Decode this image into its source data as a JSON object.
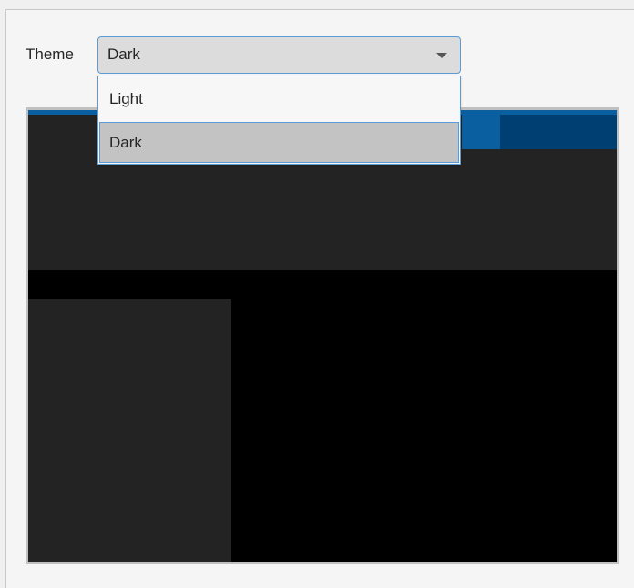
{
  "theme_selector": {
    "label": "Theme",
    "selected": "Dark",
    "options": [
      {
        "label": "Light"
      },
      {
        "label": "Dark"
      }
    ]
  },
  "colors": {
    "accent": "#5b9bd5",
    "preview_background": "#000000",
    "preview_panel": "#232323",
    "preview_tab_active": "#0a5fa0",
    "preview_tab": "#003f72"
  },
  "icons": {
    "dropdown_arrow": "chevron-down-icon"
  }
}
